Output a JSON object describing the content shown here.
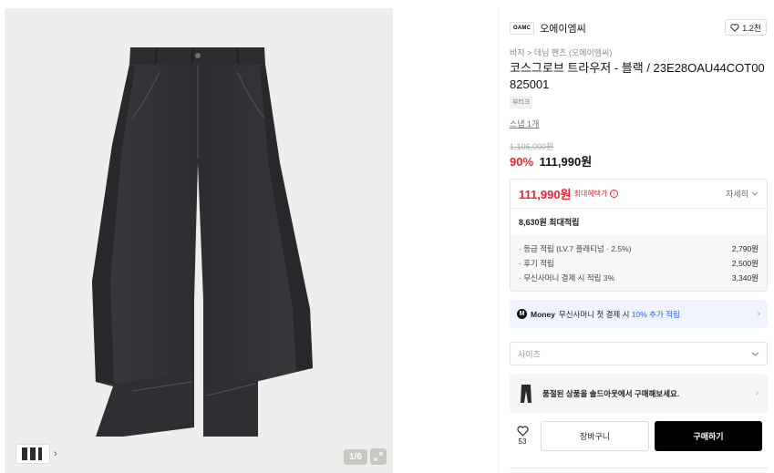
{
  "gallery": {
    "counter": "1/6",
    "thumb_arrow": "›"
  },
  "brand": {
    "logo_text": "OAMC",
    "name": "오에이엠씨",
    "likes": "1.2천"
  },
  "product": {
    "breadcrumb": "바지 > 데님 팬츠 (오에이엠씨)",
    "title": "코스그로브 트라우저 - 블랙 / 23E28OAU44COT00825001",
    "badge": "부티크",
    "snap_link": "스냅 1개",
    "original_price": "1,106,000원",
    "discount": "90%",
    "sale_price": "111,990원"
  },
  "benefit": {
    "price": "111,990원",
    "label": "최대혜택가",
    "info_icon": "ⓘ",
    "toggle_label": "자세히",
    "points_label": "8,630원 최대적립",
    "lines": [
      {
        "label": "· 등급 적립 (LV.7 플래티넘 · 2.5%)",
        "amount": "2,790원"
      },
      {
        "label": "· 후기 적립",
        "amount": "2,500원"
      },
      {
        "label": "· 무신사머니 결제 시 적립 3%",
        "amount": "3,340원"
      }
    ]
  },
  "money_banner": {
    "logo": "M",
    "brand": "Money",
    "text_pre": "무신사머니 첫 결제 시 ",
    "highlight": "10% 추가 적립"
  },
  "size_select": {
    "placeholder": "사이즈"
  },
  "soldout_banner": {
    "text": "품절된 상품을 솔드아웃에서 구매해보세요."
  },
  "actions": {
    "like_count": "53",
    "cart_label": "장바구니",
    "buy_label": "구매하기"
  },
  "colors": {
    "accent_red": "#f5222d",
    "money_blue": "#2962ff",
    "buy_black": "#000000"
  }
}
